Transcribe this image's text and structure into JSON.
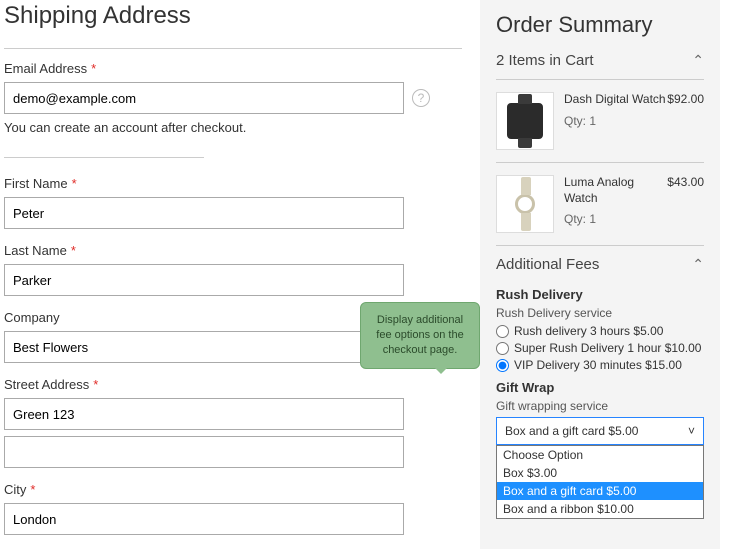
{
  "shipping": {
    "title": "Shipping Address",
    "email_label": "Email Address",
    "email_value": "demo@example.com",
    "account_note": "You can create an account after checkout.",
    "first_name_label": "First Name",
    "first_name_value": "Peter",
    "last_name_label": "Last Name",
    "last_name_value": "Parker",
    "company_label": "Company",
    "company_value": "Best Flowers",
    "street_label": "Street Address",
    "street1_value": "Green 123",
    "street2_value": "",
    "city_label": "City",
    "city_value": "London"
  },
  "callout": {
    "text": "Display additional fee options on the checkout page."
  },
  "summary": {
    "title": "Order Summary",
    "cart_header": "2 Items in Cart",
    "items": [
      {
        "name": "Dash Digital Watch",
        "qty": "Qty: 1",
        "price": "$92.00"
      },
      {
        "name": "Luma Analog Watch",
        "qty": "Qty: 1",
        "price": "$43.00"
      }
    ],
    "additional_title": "Additional Fees",
    "rush": {
      "title": "Rush Delivery",
      "subtitle": "Rush Delivery service",
      "options": [
        {
          "label": "Rush delivery 3 hours $5.00",
          "checked": false
        },
        {
          "label": "Super Rush Delivery 1 hour $10.00",
          "checked": false
        },
        {
          "label": "VIP Delivery 30 minutes $15.00",
          "checked": true
        }
      ]
    },
    "gift": {
      "title": "Gift Wrap",
      "subtitle": "Gift wrapping service",
      "selected": "Box and a gift card $5.00",
      "options": [
        "Choose Option",
        "Box $3.00",
        "Box and a gift card $5.00",
        "Box and a ribbon $10.00"
      ]
    }
  }
}
